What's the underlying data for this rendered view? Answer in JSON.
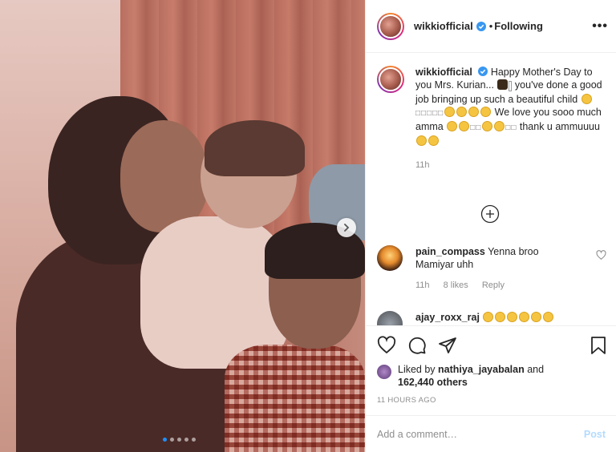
{
  "post": {
    "username": "wikkiofficial",
    "follow_separator": "•",
    "follow_status": "Following",
    "more_label": "•••"
  },
  "caption": {
    "username": "wikkiofficial",
    "text_1": "Happy Mother's Day to you Mrs. Kurian... ",
    "text_2": " you've done a good job bringing up such a beautiful child ",
    "text_3": " We love you sooo much amma ",
    "text_4": " thank u ammuuuu ",
    "time": "11h"
  },
  "comments": [
    {
      "username": "pain_compass",
      "text": "Yenna broo Mamiyar uhh",
      "time": "11h",
      "likes": "8 likes",
      "reply": "Reply"
    },
    {
      "username": "ajay_roxx_raj",
      "text": ""
    }
  ],
  "likes": {
    "liked_by_prefix": "Liked by ",
    "liked_by_user": "nathiya_jayabalan",
    "and": " and",
    "count": "162,440",
    "others": " others"
  },
  "timestamp": "11 HOURS AGO",
  "add_comment": {
    "placeholder": "Add a comment…",
    "post_label": "Post"
  },
  "carousel": {
    "total_slides": 5,
    "active_slide": 1
  },
  "colors": {
    "verified_blue": "#3897f0",
    "link_muted": "#8e8e8e",
    "post_disabled": "#b3dbff"
  }
}
